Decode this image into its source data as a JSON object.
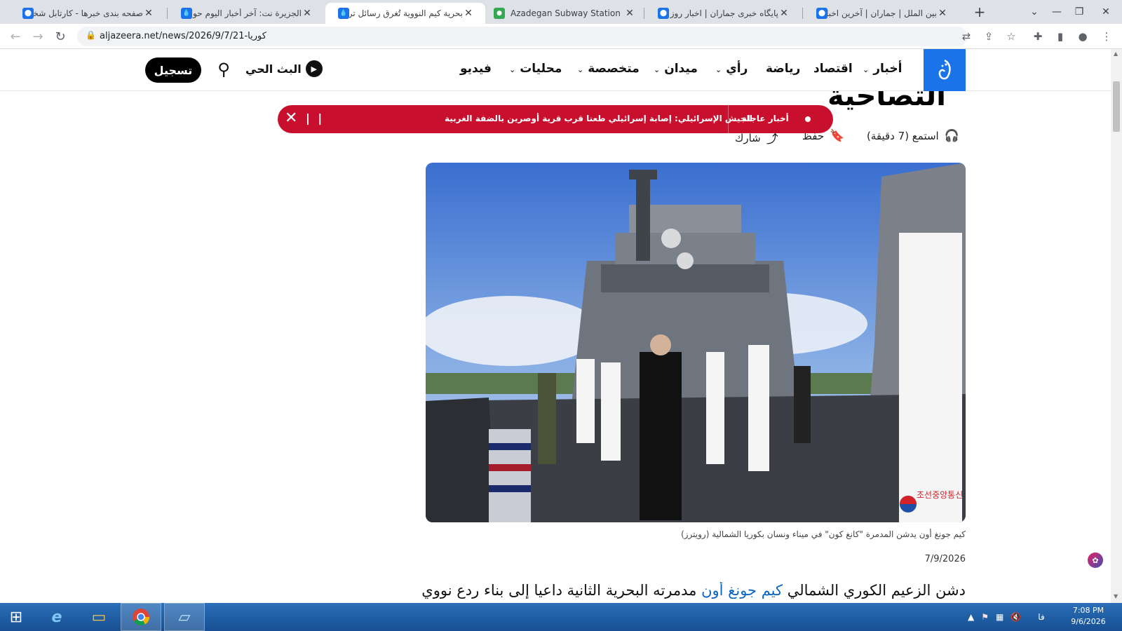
{
  "browser": {
    "tabs": [
      {
        "title": "صفحه بندی خبرها - کارتابل شخص",
        "favicon": "aljazeera-favicon",
        "active": false
      },
      {
        "title": "الجزيرة نت: آخر أخبار اليوم حول ال",
        "favicon": "water-drop-favicon",
        "active": false
      },
      {
        "title": "بحرية كيم النووية تُغرق رسائل تر",
        "favicon": "water-drop-favicon",
        "active": true
      },
      {
        "title": "Azadegan Subway Station - Go",
        "favicon": "maps-pin-favicon",
        "active": false
      },
      {
        "title": "پایگاه خبری جماران | اخبار روز ایرا",
        "favicon": "aljazeera-favicon",
        "active": false
      },
      {
        "title": "بین الملل | جماران | آخرین اخبار ا",
        "favicon": "aljazeera-favicon",
        "active": false
      }
    ],
    "new_tab": "+",
    "url": "aljazeera.net/news/2026/9/7/21-كوريا"
  },
  "site": {
    "nav": [
      {
        "label": "أخبار",
        "has_dropdown": true
      },
      {
        "label": "اقتصاد",
        "has_dropdown": false
      },
      {
        "label": "رياضة",
        "has_dropdown": false
      },
      {
        "label": "رأي",
        "has_dropdown": true
      },
      {
        "label": "ميدان",
        "has_dropdown": true
      },
      {
        "label": "متخصصة",
        "has_dropdown": true
      },
      {
        "label": "محليات",
        "has_dropdown": true
      },
      {
        "label": "فيديو",
        "has_dropdown": false
      }
    ],
    "live_label": "البث الحي",
    "register_label": "تسجيل"
  },
  "article": {
    "headline_tail": "التصاحية",
    "breaking": {
      "label": "أخبار عاجلة",
      "text": "الجيش الإسرائيلي: إصابة إسرائيلي طعنا قرب قرية أوصرين بالضفة الغربية"
    },
    "actions": {
      "listen": "استمع (7 دقيقة)",
      "save": "حفظ",
      "share": "شارك"
    },
    "image_caption": "كيم جونغ أون يدشن المدمرة \"كانغ كون\" في ميناء ونسان بكوريا الشمالية (رويترز)",
    "date": "7/9/2026",
    "lead_before": "دشن الزعيم الكوري الشمالي",
    "lead_link": "كيم جونغ أون",
    "lead_after": "مدمرته البحرية الثانية داعيا إلى بناء ردع نووي",
    "watermark": "조선중앙통신"
  },
  "taskbar": {
    "tray_lang": "فا",
    "time": "7:08 PM",
    "date": "9/6/2026"
  },
  "colors": {
    "breaking_red": "#c8102e",
    "logo_blue": "#1a73e8",
    "link_blue": "#0b66c3",
    "taskbar_blue": "#1c5fa8"
  }
}
